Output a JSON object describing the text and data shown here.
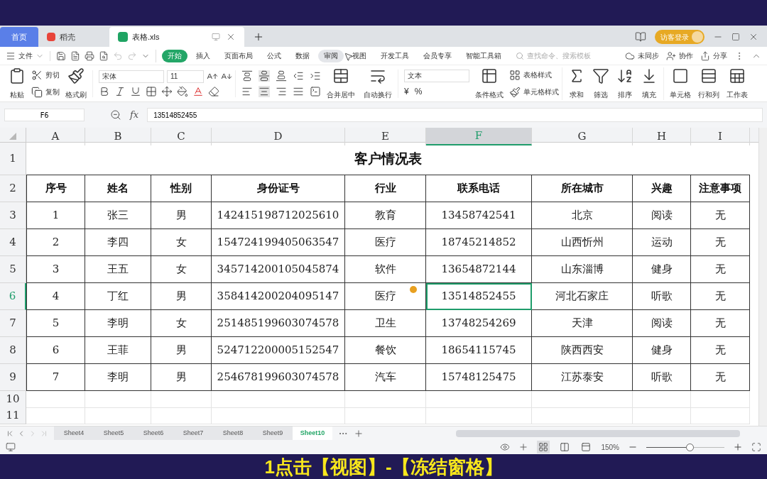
{
  "title_tabs": [
    {
      "label": "首页",
      "kind": "home",
      "selected": false
    },
    {
      "label": "稻壳",
      "kind": "docer",
      "selected": false
    },
    {
      "label": "表格.xls",
      "kind": "sheet",
      "selected": true
    }
  ],
  "login": "访客登录",
  "file_menu": "文件",
  "menu_tabs": [
    {
      "label": "开始",
      "selected": true,
      "hovered": false
    },
    {
      "label": "插入",
      "selected": false,
      "hovered": false
    },
    {
      "label": "页面布局",
      "selected": false,
      "hovered": false
    },
    {
      "label": "公式",
      "selected": false,
      "hovered": false
    },
    {
      "label": "数据",
      "selected": false,
      "hovered": false
    },
    {
      "label": "审阅",
      "selected": false,
      "hovered": true
    },
    {
      "label": "视图",
      "selected": false,
      "hovered": false
    },
    {
      "label": "开发工具",
      "selected": false,
      "hovered": false
    },
    {
      "label": "会员专享",
      "selected": false,
      "hovered": false
    },
    {
      "label": "智能工具箱",
      "selected": false,
      "hovered": false
    }
  ],
  "search": {
    "placeholder": "查找命令、搜索模板"
  },
  "menu_actions": [
    "未同步",
    "协作",
    "分享"
  ],
  "ribbon": {
    "paste": "粘贴",
    "cut": "剪切",
    "copy": "复制",
    "format_painter": "格式刷",
    "font": "宋体",
    "font_size": "11",
    "merge": "合并居中",
    "wrap": "自动换行",
    "number_format": "文本",
    "currency": "¥",
    "percent": "%",
    "conditional": "条件格式",
    "table_style": "表格样式",
    "cell_style": "单元格样式",
    "tools": [
      "求和",
      "筛选",
      "排序",
      "填充"
    ],
    "cells": [
      "单元格",
      "行和列",
      "工作表"
    ]
  },
  "name_box": "F6",
  "function_label": "fx",
  "formula": "13514852455",
  "columns": [
    {
      "label": "A",
      "selected": false
    },
    {
      "label": "B",
      "selected": false
    },
    {
      "label": "C",
      "selected": false
    },
    {
      "label": "D",
      "selected": false
    },
    {
      "label": "E",
      "selected": false
    },
    {
      "label": "F",
      "selected": true
    },
    {
      "label": "G",
      "selected": false
    },
    {
      "label": "H",
      "selected": false
    },
    {
      "label": "I",
      "selected": false
    }
  ],
  "row_numbers": [
    {
      "label": "1",
      "selected": false
    },
    {
      "label": "2",
      "selected": false
    },
    {
      "label": "3",
      "selected": false
    },
    {
      "label": "4",
      "selected": false
    },
    {
      "label": "5",
      "selected": false
    },
    {
      "label": "6",
      "selected": true
    },
    {
      "label": "7",
      "selected": false
    },
    {
      "label": "8",
      "selected": false
    },
    {
      "label": "9",
      "selected": false
    },
    {
      "label": "10",
      "selected": false
    },
    {
      "label": "11",
      "selected": false
    }
  ],
  "title": "客户情况表",
  "header": [
    "序号",
    "姓名",
    "性别",
    "身份证号",
    "行业",
    "联系电话",
    "所在城市",
    "兴趣",
    "注意事项"
  ],
  "rows": [
    {
      "note": false,
      "cells": [
        {
          "text": "1",
          "active": false
        },
        {
          "text": "张三",
          "active": false
        },
        {
          "text": "男",
          "active": false
        },
        {
          "text": "142415198712025610",
          "active": false
        },
        {
          "text": "教育",
          "active": false
        },
        {
          "text": "13458742541",
          "active": false
        },
        {
          "text": "北京",
          "active": false
        },
        {
          "text": "阅读",
          "active": false
        },
        {
          "text": "无",
          "active": false
        }
      ]
    },
    {
      "note": false,
      "cells": [
        {
          "text": "2",
          "active": false
        },
        {
          "text": "李四",
          "active": false
        },
        {
          "text": "女",
          "active": false
        },
        {
          "text": "154724199405063547",
          "active": false
        },
        {
          "text": "医疗",
          "active": false
        },
        {
          "text": "18745214852",
          "active": false
        },
        {
          "text": "山西忻州",
          "active": false
        },
        {
          "text": "运动",
          "active": false
        },
        {
          "text": "无",
          "active": false
        }
      ]
    },
    {
      "note": false,
      "cells": [
        {
          "text": "3",
          "active": false
        },
        {
          "text": "王五",
          "active": false
        },
        {
          "text": "女",
          "active": false
        },
        {
          "text": "345714200105045874",
          "active": false
        },
        {
          "text": "软件",
          "active": false
        },
        {
          "text": "13654872144",
          "active": false
        },
        {
          "text": "山东淄博",
          "active": false
        },
        {
          "text": "健身",
          "active": false
        },
        {
          "text": "无",
          "active": false
        }
      ]
    },
    {
      "note": true,
      "cells": [
        {
          "text": "4",
          "active": false
        },
        {
          "text": "丁红",
          "active": false
        },
        {
          "text": "男",
          "active": false
        },
        {
          "text": "358414200204095147",
          "active": false
        },
        {
          "text": "医疗",
          "active": false
        },
        {
          "text": "13514852455",
          "active": true
        },
        {
          "text": "河北石家庄",
          "active": false
        },
        {
          "text": "听歌",
          "active": false
        },
        {
          "text": "无",
          "active": false
        }
      ]
    },
    {
      "note": false,
      "cells": [
        {
          "text": "5",
          "active": false
        },
        {
          "text": "李明",
          "active": false
        },
        {
          "text": "女",
          "active": false
        },
        {
          "text": "251485199603074578",
          "active": false
        },
        {
          "text": "卫生",
          "active": false
        },
        {
          "text": "13748254269",
          "active": false
        },
        {
          "text": "天津",
          "active": false
        },
        {
          "text": "阅读",
          "active": false
        },
        {
          "text": "无",
          "active": false
        }
      ]
    },
    {
      "note": false,
      "cells": [
        {
          "text": "6",
          "active": false
        },
        {
          "text": "王菲",
          "active": false
        },
        {
          "text": "男",
          "active": false
        },
        {
          "text": "524712200005152547",
          "active": false
        },
        {
          "text": "餐饮",
          "active": false
        },
        {
          "text": "18654115745",
          "active": false
        },
        {
          "text": "陕西西安",
          "active": false
        },
        {
          "text": "健身",
          "active": false
        },
        {
          "text": "无",
          "active": false
        }
      ]
    },
    {
      "note": false,
      "cells": [
        {
          "text": "7",
          "active": false
        },
        {
          "text": "李明",
          "active": false
        },
        {
          "text": "男",
          "active": false
        },
        {
          "text": "254678199603074578",
          "active": false
        },
        {
          "text": "汽车",
          "active": false
        },
        {
          "text": "15748125475",
          "active": false
        },
        {
          "text": "江苏泰安",
          "active": false
        },
        {
          "text": "听歌",
          "active": false
        },
        {
          "text": "无",
          "active": false
        }
      ]
    }
  ],
  "sheet_tabs": [
    {
      "label": "Sheet4",
      "selected": false
    },
    {
      "label": "Sheet5",
      "selected": false
    },
    {
      "label": "Sheet6",
      "selected": false
    },
    {
      "label": "Sheet7",
      "selected": false
    },
    {
      "label": "Sheet8",
      "selected": false
    },
    {
      "label": "Sheet9",
      "selected": false
    },
    {
      "label": "Sheet10",
      "selected": true
    }
  ],
  "views": [
    {
      "kind": "normal",
      "selected": true
    },
    {
      "kind": "page",
      "selected": false
    },
    {
      "kind": "break",
      "selected": false
    }
  ],
  "zoom": {
    "reading": "150%",
    "level": 0.55
  },
  "caption": "1点击【视图】-【冻结窗格】"
}
